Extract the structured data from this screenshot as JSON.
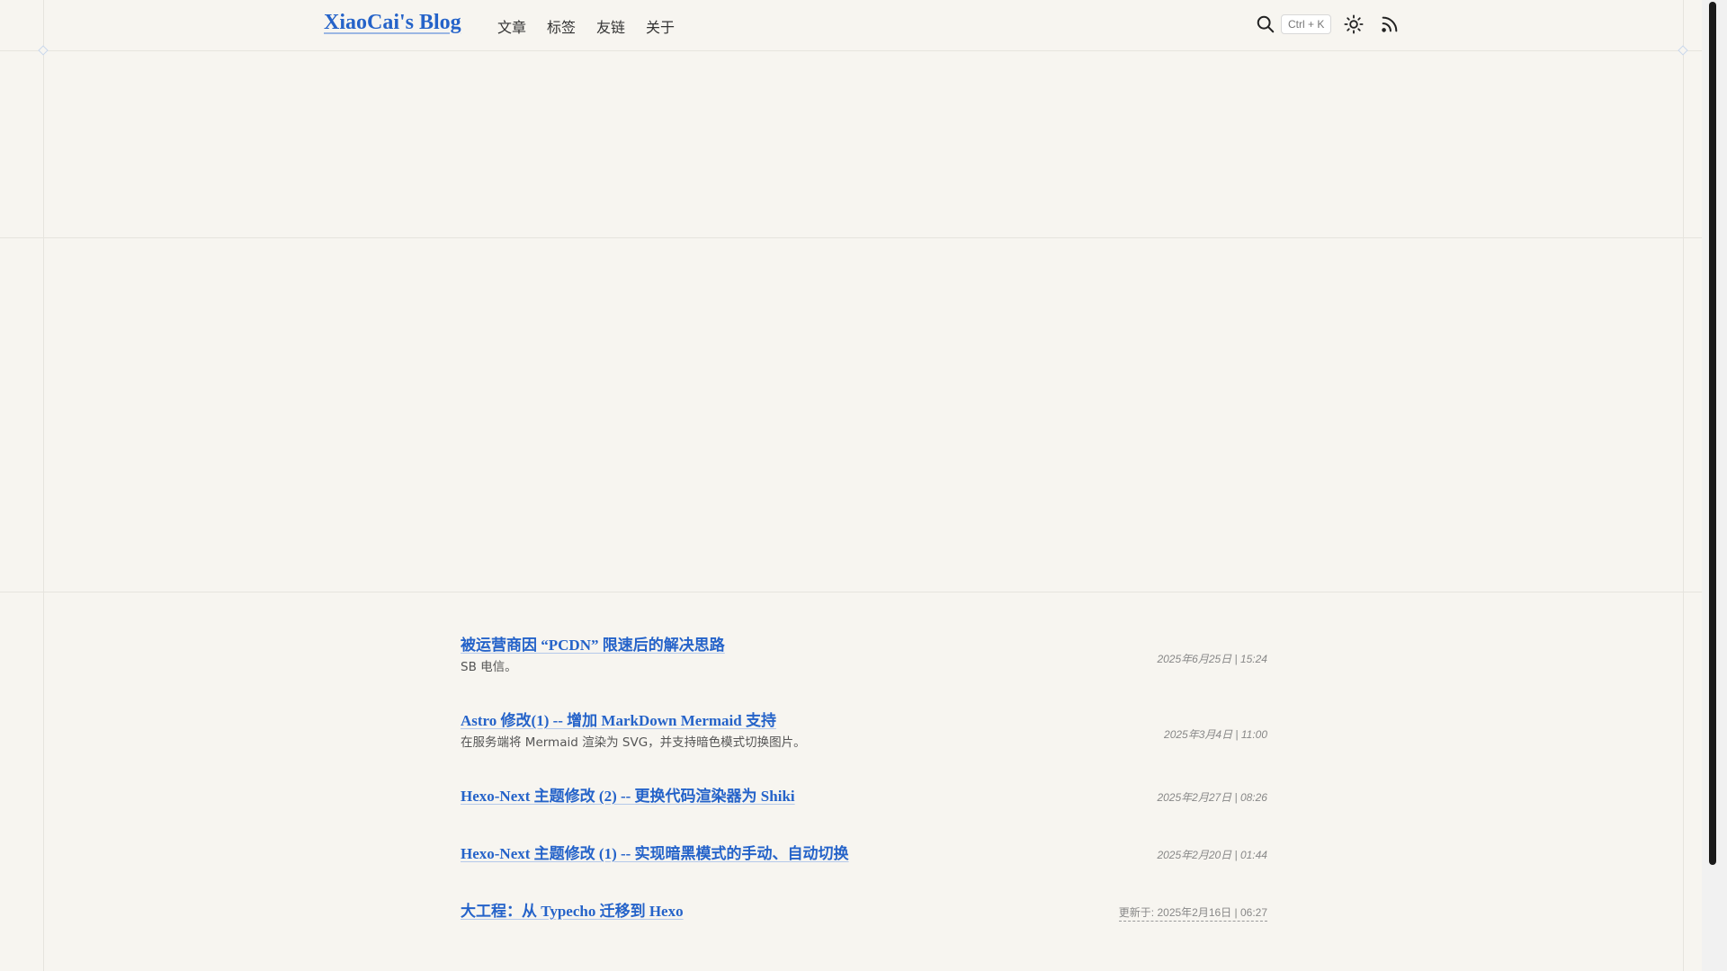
{
  "site": {
    "title": "XiaoCai's Blog"
  },
  "nav": {
    "items": [
      {
        "label": "文章"
      },
      {
        "label": "标签"
      },
      {
        "label": "友链"
      },
      {
        "label": "关于"
      }
    ]
  },
  "toolbar": {
    "search_shortcut": "Ctrl + K",
    "search_icon": "search-icon",
    "theme_icon": "sun-icon",
    "rss_icon": "rss-icon"
  },
  "posts": [
    {
      "title": "被运营商因 “PCDN” 限速后的解决思路",
      "desc": "SB 电信。",
      "date": "2025年6月25日 | 15:24"
    },
    {
      "title": "Astro 修改(1) -- 增加 MarkDown Mermaid 支持",
      "desc": "在服务端将 Mermaid 渲染为 SVG，并支持暗色模式切换图片。",
      "date": "2025年3月4日 | 11:00"
    },
    {
      "title": "Hexo-Next 主题修改 (2) -- 更换代码渲染器为 Shiki",
      "desc": "",
      "date": "2025年2月27日 | 08:26"
    },
    {
      "title": "Hexo-Next 主题修改 (1) -- 实现暗黑模式的手动、自动切换",
      "desc": "",
      "date": "2025年2月20日 | 01:44"
    },
    {
      "title": "大工程：从 Typecho 迁移到 Hexo",
      "desc": "",
      "date": "更新于: 2025年2月16日 | 06:27"
    }
  ],
  "colors": {
    "accent": "#2563c9",
    "background": "#f7f5f0"
  }
}
